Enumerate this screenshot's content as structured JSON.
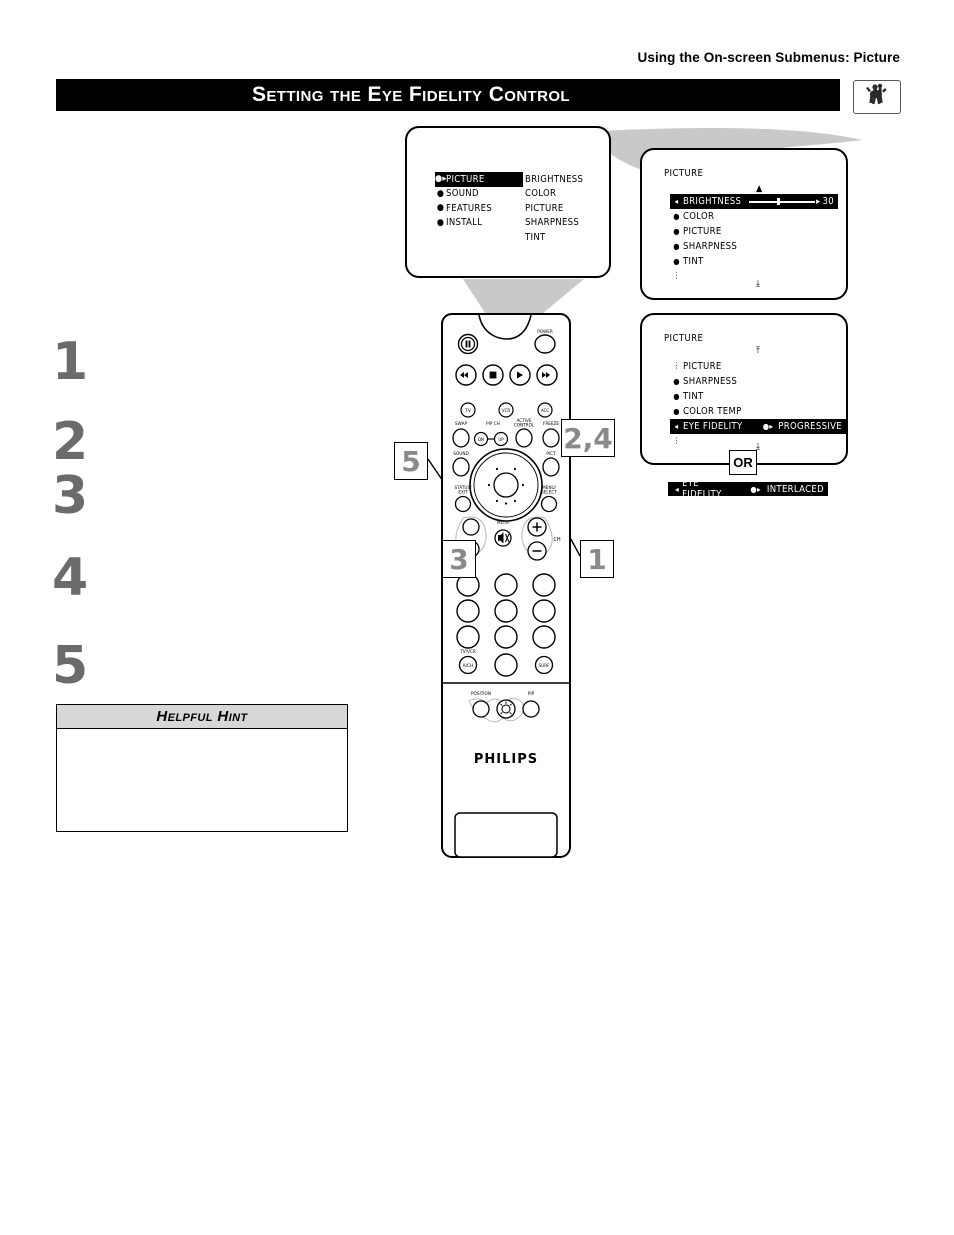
{
  "header": {
    "breadcrumb": "Using the On-screen Submenus: Picture",
    "title": "Setting the Eye Fidelity Control",
    "thumb_icon": "horse-rider-image-icon"
  },
  "steps": {
    "numbers": [
      "1",
      "2",
      "3",
      "4",
      "5"
    ],
    "texts": [
      "",
      "",
      "",
      "",
      ""
    ]
  },
  "hint": {
    "title": "Helpful Hint",
    "body": ""
  },
  "callouts": {
    "menu_select": "1",
    "updown": "2,4",
    "leftright": "3",
    "status_exit": "5"
  },
  "or_badge": "OR",
  "tv_main_menu": {
    "left_column": [
      {
        "bullet": "●▸",
        "label": "PICTURE",
        "highlight": true
      },
      {
        "bullet": "●",
        "label": "SOUND",
        "highlight": false
      },
      {
        "bullet": "●",
        "label": "FEATURES",
        "highlight": false
      },
      {
        "bullet": "●",
        "label": "INSTALL",
        "highlight": false
      }
    ],
    "right_column": [
      "BRIGHTNESS",
      "COLOR",
      "PICTURE",
      "SHARPNESS",
      "TINT"
    ]
  },
  "tv_brightness_menu": {
    "title": "PICTURE",
    "scroll_up": "▲",
    "scroll_down": "⤓",
    "items": [
      {
        "mark": "◂",
        "label": "BRIGHTNESS",
        "selected": true,
        "slider": true,
        "value": "30",
        "slider_arrow": "▸"
      },
      {
        "mark": "●",
        "label": "COLOR",
        "selected": false
      },
      {
        "mark": "●",
        "label": "PICTURE",
        "selected": false
      },
      {
        "mark": "●",
        "label": "SHARPNESS",
        "selected": false
      },
      {
        "mark": "●",
        "label": "TINT",
        "selected": false
      },
      {
        "mark": "⋮",
        "label": "",
        "selected": false
      }
    ]
  },
  "tv_eyefidelity_menu": {
    "title": "PICTURE",
    "scroll_up": "⤒",
    "scroll_down": "⤓",
    "items": [
      {
        "mark": "⋮",
        "label": "PICTURE",
        "selected": false
      },
      {
        "mark": "●",
        "label": "SHARPNESS",
        "selected": false
      },
      {
        "mark": "●",
        "label": "TINT",
        "selected": false
      },
      {
        "mark": "●",
        "label": "COLOR TEMP",
        "selected": false
      },
      {
        "mark": "◂",
        "label": "EYE FIDELITY",
        "selected": true,
        "optmark": "●▸",
        "value": "PROGRESSIVE"
      },
      {
        "mark": "⋮",
        "label": "",
        "selected": false
      }
    ]
  },
  "tv_alt_bar": {
    "mark": "◂",
    "label": "EYE FIDELITY",
    "optmark": "●▸",
    "value": "INTERLACED"
  },
  "remote": {
    "brand": "PHILIPS",
    "buttons": {
      "power": "POWER",
      "pause": "‖",
      "rewind": "◂◂",
      "stop": "■",
      "play": "▸",
      "forward": "▸▸",
      "tv": "TV",
      "vcr": "VCR",
      "acc": "ACC",
      "swap": "SWAP",
      "pip_ch": "PIP CH",
      "pip_dn": "DN",
      "pip_up": "UP",
      "active_control": "ACTIVE CONTROL",
      "freeze": "FREEZE",
      "sound": "SOUND",
      "pict": "PICT",
      "status_exit": "STATUS/ EXIT",
      "menu_select": "MENU/ SELECT",
      "mute": "MUTE",
      "ch": "CH",
      "vol_plus": "+",
      "vol_minus": "−",
      "tv_vcr": "TV/VCR",
      "a_ch": "A/CH",
      "surf": "SURF",
      "position": "POSITION",
      "pip": "PIP"
    }
  },
  "colors": {
    "accent_gray": "#8a8a8a",
    "step_gray": "#6b6b6b",
    "connector_gray": "#c9c9c9",
    "black": "#000000",
    "hint_header": "#d7d7d7"
  }
}
